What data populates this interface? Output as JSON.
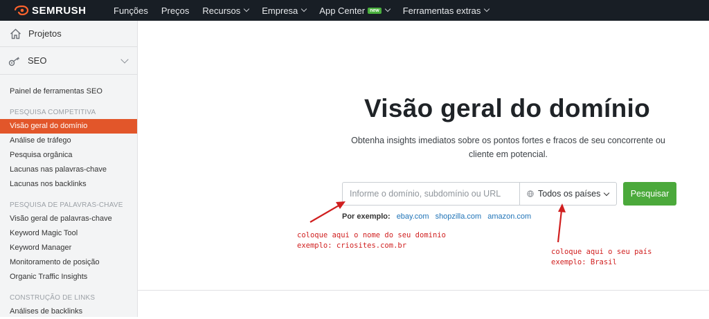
{
  "topbar": {
    "logo_text": "SEMRUSH",
    "nav": [
      {
        "label": "Funções",
        "dropdown": false
      },
      {
        "label": "Preços",
        "dropdown": false
      },
      {
        "label": "Recursos",
        "dropdown": true
      },
      {
        "label": "Empresa",
        "dropdown": true
      },
      {
        "label": "App Center",
        "dropdown": true,
        "badge": "new"
      },
      {
        "label": "Ferramentas extras",
        "dropdown": true
      }
    ]
  },
  "sidebar": {
    "projects_label": "Projetos",
    "seo_label": "SEO",
    "items": [
      {
        "type": "item",
        "label": "Painel de ferramentas SEO"
      },
      {
        "type": "head",
        "label": "PESQUISA COMPETITIVA"
      },
      {
        "type": "item",
        "label": "Visão geral do domínio",
        "active": true
      },
      {
        "type": "item",
        "label": "Análise de tráfego"
      },
      {
        "type": "item",
        "label": "Pesquisa orgânica"
      },
      {
        "type": "item",
        "label": "Lacunas nas palavras-chave"
      },
      {
        "type": "item",
        "label": "Lacunas nos backlinks"
      },
      {
        "type": "head",
        "label": "PESQUISA DE PALAVRAS-CHAVE"
      },
      {
        "type": "item",
        "label": "Visão geral de palavras-chave"
      },
      {
        "type": "item",
        "label": "Keyword Magic Tool"
      },
      {
        "type": "item",
        "label": "Keyword Manager"
      },
      {
        "type": "item",
        "label": "Monitoramento de posição"
      },
      {
        "type": "item",
        "label": "Organic Traffic Insights"
      },
      {
        "type": "head",
        "label": "CONSTRUÇÃO DE LINKS"
      },
      {
        "type": "item",
        "label": "Análises de backlinks"
      }
    ]
  },
  "main": {
    "title": "Visão geral do domínio",
    "subtitle": "Obtenha insights imediatos sobre os pontos fortes e fracos de seu concorrente ou cliente em potencial.",
    "search_placeholder": "Informe o domínio, subdomínio ou URL",
    "country_value": "Todos os países",
    "search_button": "Pesquisar",
    "examples_label": "Por exemplo:",
    "examples": [
      "ebay.com",
      "shopzilla.com",
      "amazon.com"
    ]
  },
  "annotations": {
    "domain_note_line1": "coloque aqui o nome do seu dominio",
    "domain_note_line2": "exemplo: criosites.com.br",
    "country_note_line1": "coloque aqui o seu país",
    "country_note_line2": "exemplo: Brasil"
  },
  "colors": {
    "topbar_bg": "#181e25",
    "accent_orange": "#e2562a",
    "button_green": "#4ba93b",
    "link_blue": "#1f73b7",
    "annotation_red": "#d01f1f"
  }
}
